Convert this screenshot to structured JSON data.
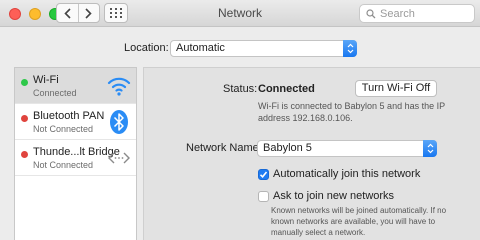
{
  "window": {
    "title": "Network"
  },
  "toolbar": {
    "search_placeholder": "Search"
  },
  "location": {
    "label": "Location:",
    "value": "Automatic"
  },
  "services": [
    {
      "name": "Wi-Fi",
      "status": "Connected",
      "status_color": "#2ec84a",
      "icon": "wifi-icon"
    },
    {
      "name": "Bluetooth PAN",
      "status": "Not Connected",
      "status_color": "#e0443e",
      "icon": "bluetooth-icon"
    },
    {
      "name": "Thunde...lt Bridge",
      "status": "Not Connected",
      "status_color": "#e0443e",
      "icon": "thunderbolt-bridge-icon"
    }
  ],
  "detail": {
    "status_label": "Status:",
    "status_value": "Connected",
    "turn_off_button": "Turn Wi-Fi Off",
    "status_description": "Wi-Fi is connected to Babylon 5 and has the IP address 192.168.0.106.",
    "network_name_label": "Network Name:",
    "network_name_value": "Babylon 5",
    "auto_join_label": "Automatically join this network",
    "auto_join_checked": true,
    "ask_join_label": "Ask to join new networks",
    "ask_join_checked": false,
    "ask_join_hint": "Known networks will be joined automatically. If no known networks are available, you will have to manually select a network."
  },
  "colors": {
    "accent": "#1f7cf2",
    "connected": "#2ec84a",
    "disconnected": "#e0443e"
  }
}
